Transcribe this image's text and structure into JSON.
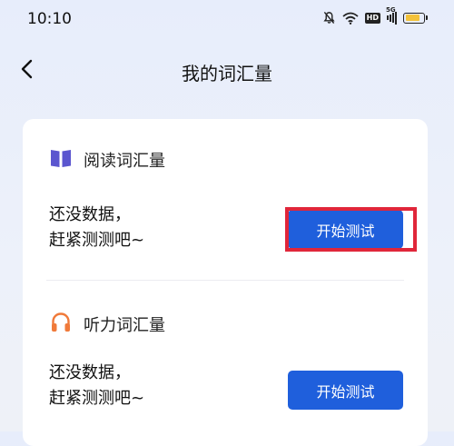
{
  "status_bar": {
    "time": "10:10",
    "hd_label": "HD",
    "network_label": "5G",
    "battery_level": 0.8,
    "battery_color": "#f3c23a",
    "icons": [
      "mute-bell-icon",
      "wifi-icon",
      "hd-icon",
      "signal-5g-icon",
      "battery-icon"
    ]
  },
  "nav": {
    "title": "我的词汇量",
    "back_icon": "chevron-left-icon"
  },
  "sections": [
    {
      "icon": "book-icon",
      "icon_color": "#5b56cf",
      "title": "阅读词汇量",
      "message_line1": "还没数据，",
      "message_line2": "赶紧测测吧~",
      "button_label": "开始测试",
      "highlighted": true
    },
    {
      "icon": "headphones-icon",
      "icon_color": "#f07a3a",
      "title": "听力词汇量",
      "message_line1": "还没数据，",
      "message_line2": "赶紧测测吧~",
      "button_label": "开始测试",
      "highlighted": false
    }
  ],
  "colors": {
    "primary_button": "#1f5fdc",
    "highlight_border": "#e0263a"
  }
}
